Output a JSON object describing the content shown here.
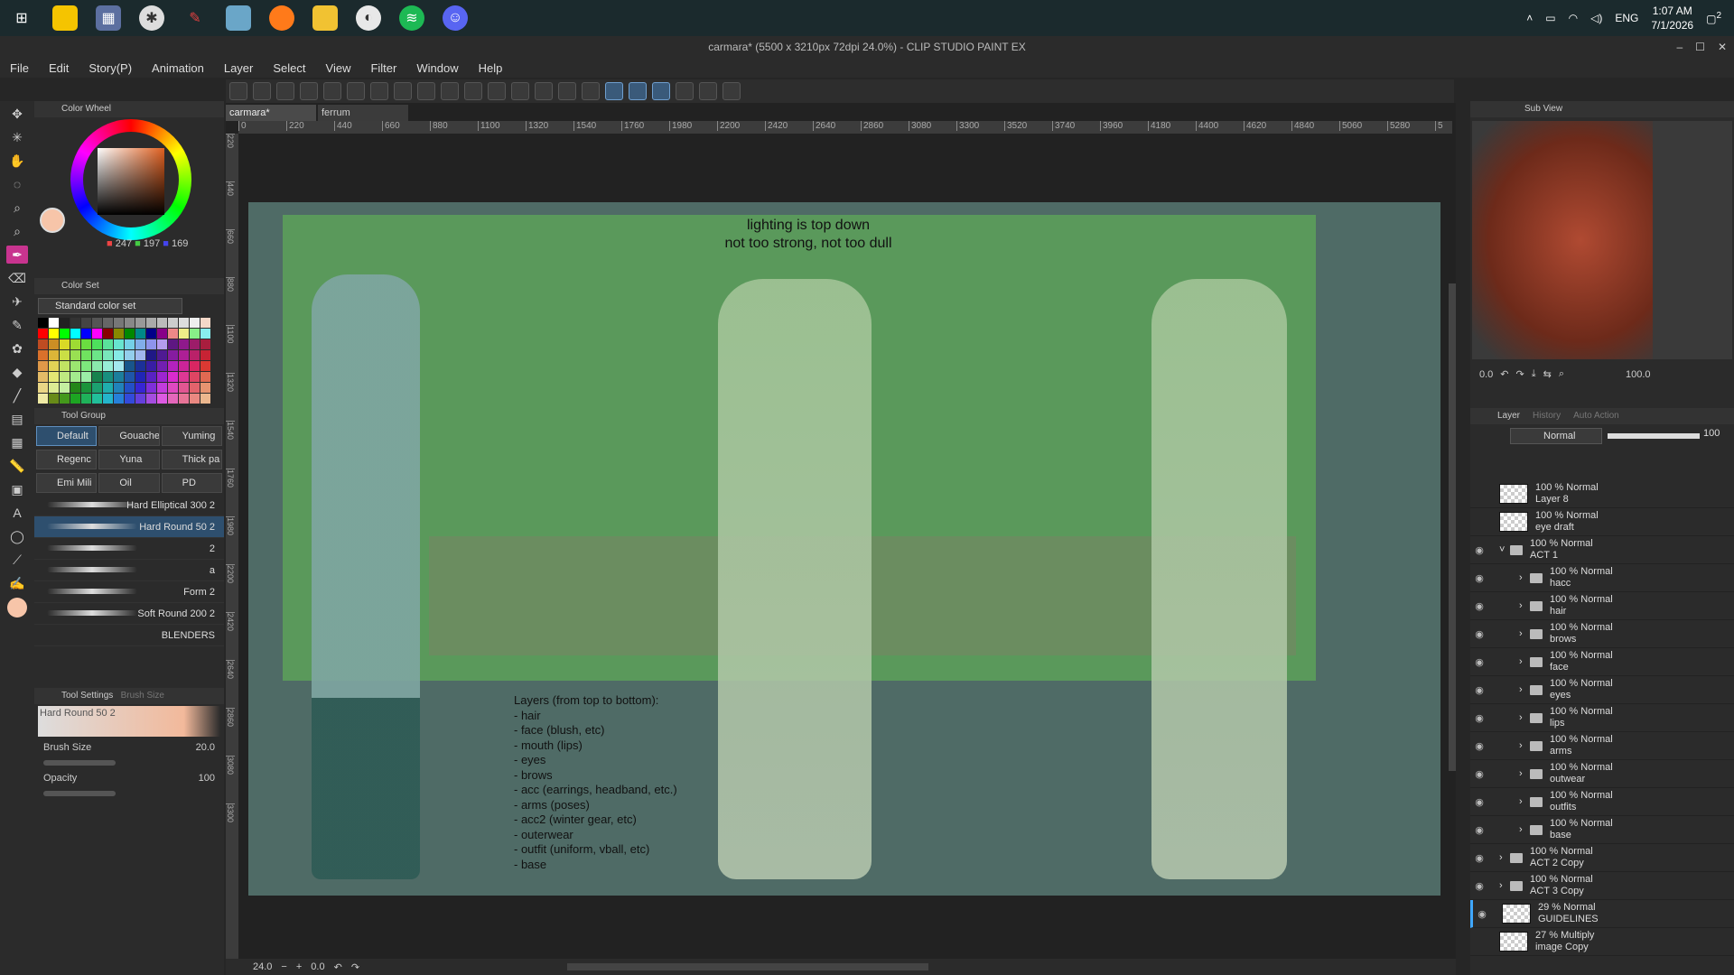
{
  "taskbar": {
    "apps": [
      "windows-icon",
      "sticky-notes-icon",
      "calculator-icon",
      "browser-icon",
      "sketch-app-icon",
      "notebook-icon",
      "firefox-icon",
      "file-explorer-icon",
      "clip-studio-icon",
      "spotify-icon",
      "discord-icon"
    ],
    "language": "ENG",
    "time": "1:07 AM",
    "date": "7/1/2026",
    "notification_count": "2"
  },
  "window": {
    "title": "carmara* (5500 x 3210px 72dpi 24.0%) - CLIP STUDIO PAINT EX"
  },
  "menu": [
    "File",
    "Edit",
    "Story(P)",
    "Animation",
    "Layer",
    "Select",
    "View",
    "Filter",
    "Window",
    "Help"
  ],
  "color_wheel": {
    "title": "Color Wheel",
    "r": "247",
    "g": "197",
    "b": "169",
    "color": "#f7c5a9"
  },
  "color_set": {
    "title": "Color Set",
    "selected": "Standard color set"
  },
  "tool_group": {
    "title": "Tool Group",
    "tabs": [
      "Default",
      "Gouache",
      "Yuming",
      "Regenc",
      "Yuna",
      "Thick pa",
      "Emi Mili",
      "Oil",
      "PD"
    ],
    "brushes": [
      "Hard Elliptical 300 2",
      "Hard Round 50 2",
      "2",
      "a",
      "Form 2",
      "Soft Round 200 2",
      "BLENDERS"
    ],
    "selected_brush": "Hard Round 50 2"
  },
  "tool_settings": {
    "title": "Tool Settings",
    "tab2": "Brush Size",
    "brush_name": "Hard Round 50 2",
    "brush_size_label": "Brush Size",
    "brush_size": "20.0",
    "opacity_label": "Opacity",
    "opacity": "100"
  },
  "canvas": {
    "tabs": [
      "carmara*",
      "ferrum"
    ],
    "ruler_ticks": [
      "0",
      "220",
      "440",
      "660",
      "880",
      "1100",
      "1320",
      "1540",
      "1760",
      "1980",
      "2200",
      "2420",
      "2640",
      "2860",
      "3080",
      "3300",
      "3520",
      "3740",
      "3960",
      "4180",
      "4400",
      "4620",
      "4840",
      "5060",
      "5280",
      "5"
    ],
    "vruler_ticks": [
      "220",
      "440",
      "660",
      "880",
      "1100",
      "1320",
      "1540",
      "1760",
      "1980",
      "2200",
      "2420",
      "2640",
      "2860",
      "3080",
      "3300"
    ],
    "note_top": "lighting is top down\nnot too strong, not too dull",
    "note_layers": "Layers (from top to bottom):\n- hair\n- face (blush, etc)\n- mouth (lips)\n- eyes\n- brows\n- acc (earrings, headband, etc.)\n- arms (poses)\n- acc2 (winter gear, etc)\n- outerwear\n- outfit (uniform, vball, etc)\n- base"
  },
  "status": {
    "zoom": "24.0",
    "rotation": "0.0"
  },
  "sub_view": {
    "title": "Sub View",
    "zoom": "100.0",
    "angle": "0.0"
  },
  "layer_panel": {
    "tabs": [
      "Layer",
      "History",
      "Auto Action"
    ],
    "blend_mode": "Normal",
    "opacity": "100",
    "layers": [
      {
        "mode": "100 % Normal",
        "name": "Layer 8",
        "kind": "raster",
        "indent": 0,
        "visible": false
      },
      {
        "mode": "100 % Normal",
        "name": "eye draft",
        "kind": "raster",
        "indent": 0,
        "visible": false
      },
      {
        "mode": "100 % Normal",
        "name": "ACT 1",
        "kind": "folder-open",
        "indent": 0,
        "visible": true
      },
      {
        "mode": "100 % Normal",
        "name": "hacc",
        "kind": "folder",
        "indent": 1,
        "visible": true
      },
      {
        "mode": "100 % Normal",
        "name": "hair",
        "kind": "folder",
        "indent": 1,
        "visible": true
      },
      {
        "mode": "100 % Normal",
        "name": "brows",
        "kind": "folder",
        "indent": 1,
        "visible": true
      },
      {
        "mode": "100 % Normal",
        "name": "face",
        "kind": "folder",
        "indent": 1,
        "visible": true
      },
      {
        "mode": "100 % Normal",
        "name": "eyes",
        "kind": "folder",
        "indent": 1,
        "visible": true
      },
      {
        "mode": "100 % Normal",
        "name": "lips",
        "kind": "folder",
        "indent": 1,
        "visible": true
      },
      {
        "mode": "100 % Normal",
        "name": "arms",
        "kind": "folder",
        "indent": 1,
        "visible": true
      },
      {
        "mode": "100 % Normal",
        "name": "outwear",
        "kind": "folder",
        "indent": 1,
        "visible": true
      },
      {
        "mode": "100 % Normal",
        "name": "outfits",
        "kind": "folder",
        "indent": 1,
        "visible": true
      },
      {
        "mode": "100 % Normal",
        "name": "base",
        "kind": "folder",
        "indent": 1,
        "visible": true
      },
      {
        "mode": "100 % Normal",
        "name": "ACT 2 Copy",
        "kind": "folder",
        "indent": 0,
        "visible": true
      },
      {
        "mode": "100 % Normal",
        "name": "ACT 3 Copy",
        "kind": "folder",
        "indent": 0,
        "visible": true
      },
      {
        "mode": "29 % Normal",
        "name": "GUIDELINES",
        "kind": "raster",
        "indent": 0,
        "visible": true
      },
      {
        "mode": "27 % Multiply",
        "name": "image Copy",
        "kind": "raster",
        "indent": 0,
        "visible": false
      }
    ]
  }
}
